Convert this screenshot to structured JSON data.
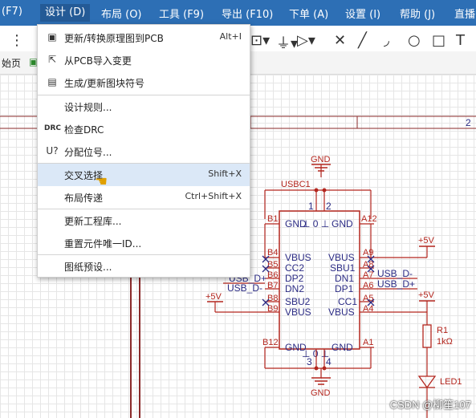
{
  "menubar": {
    "items": [
      "(F7)",
      "设计 (D)",
      "布局 (O)",
      "工具 (F9)",
      "导出 (F10)",
      "下单 (A)",
      "设置 (I)",
      "帮助 (J)",
      "直播"
    ]
  },
  "tabs": {
    "left": "始页"
  },
  "dropdown": {
    "items": [
      {
        "icon": "▣",
        "label": "更新/转换原理图到PCB",
        "shortcut": "Alt+I"
      },
      {
        "icon": "⇱",
        "label": "从PCB导入变更",
        "shortcut": ""
      },
      {
        "icon": "▤",
        "label": "生成/更新图块符号",
        "shortcut": ""
      },
      {
        "icon": "",
        "label": "设计规则...",
        "shortcut": ""
      },
      {
        "icon": "DRC",
        "label": "检查DRC",
        "shortcut": ""
      },
      {
        "icon": "U?",
        "label": "分配位号...",
        "shortcut": ""
      },
      {
        "icon": "",
        "label": "交叉选择",
        "shortcut": "Shift+X"
      },
      {
        "icon": "",
        "label": "布局传递",
        "shortcut": "Ctrl+Shift+X"
      },
      {
        "icon": "",
        "label": "更新工程库...",
        "shortcut": ""
      },
      {
        "icon": "",
        "label": "重置元件唯一ID...",
        "shortcut": ""
      },
      {
        "icon": "",
        "label": "图纸预设...",
        "shortcut": ""
      }
    ]
  },
  "schematic": {
    "frame_number": "2",
    "gnd_top": "GND",
    "gnd_bottom": "GND",
    "ref_usb": "USBC1",
    "ref_r1": "R1",
    "r1_value": "1kΩ",
    "ref_led": "LED1",
    "vcc_left": "+5V",
    "vcc_right_top": "+5V",
    "vcc_right_mid": "+5V",
    "pins_left": [
      "GND",
      "VBUS",
      "CC2",
      "DP2",
      "DN2",
      "SBU2",
      "VBUS",
      "GND"
    ],
    "pins_right": [
      "GND",
      "VBUS",
      "SBU1",
      "DN1",
      "DP1",
      "CC1",
      "VBUS",
      "GND"
    ],
    "pin_ids_left": [
      "B1",
      "B4",
      "B5",
      "B6",
      "B7",
      "B8",
      "B9",
      "B12"
    ],
    "pin_ids_right": [
      "A12",
      "A9",
      "A8",
      "A7",
      "A6",
      "A5",
      "A4",
      "A1"
    ],
    "net_usb_dm_left": "USB_D-",
    "net_usb_dp_left": "USB_D+",
    "net_usb_dm_right": "USB_D-",
    "net_usb_dp_right": "USB_D+",
    "pin_top_1": "1",
    "pin_top_2": "2",
    "pin_bot_3": "3",
    "pin_bot_4": "4",
    "shield_top": "⊥ 0 ⊥",
    "shield_bot": "⊥ 0 ⊥"
  },
  "watermark": "CSDN @柳笙107",
  "colors": {
    "menubar": "#2d6fb5",
    "wire": "#b3261e",
    "pin_text": "#2b2b84",
    "highlight": "#dbe8f7"
  }
}
